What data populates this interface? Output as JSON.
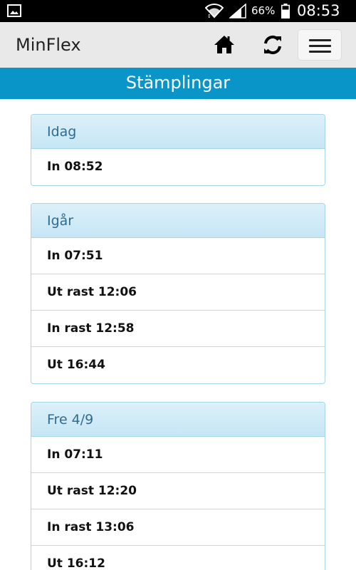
{
  "status_bar": {
    "battery_percent": "66%",
    "time": "08:53",
    "icons": [
      "gallery-icon",
      "wifi-icon",
      "signal-icon",
      "battery-icon"
    ]
  },
  "header": {
    "title": "MinFlex",
    "icons": [
      "home-icon",
      "refresh-icon",
      "menu-icon"
    ]
  },
  "page": {
    "title": "Stämplingar"
  },
  "days": [
    {
      "label": "Idag",
      "entries": [
        "In 08:52"
      ]
    },
    {
      "label": "Igår",
      "entries": [
        "In 07:51",
        "Ut rast 12:06",
        "In rast 12:58",
        "Ut 16:44"
      ]
    },
    {
      "label": "Fre 4/9",
      "entries": [
        "In 07:11",
        "Ut rast 12:20",
        "In rast 13:06",
        "Ut 16:12"
      ]
    }
  ],
  "colors": {
    "status_bar": "#000000",
    "app_bar": "#e9e9e9",
    "banner": "#0a95c8",
    "panel_header": "#cfeaf7",
    "panel_header_text": "#2f6c92",
    "panel_border": "#a9d5ea"
  }
}
